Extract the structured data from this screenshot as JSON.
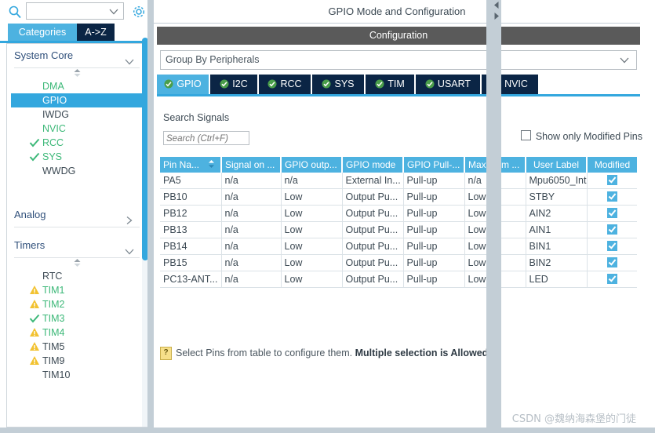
{
  "left_panel": {
    "search": {
      "value": "",
      "placeholder": ""
    },
    "search_icon": "search-icon",
    "gear_icon": "gear-icon",
    "tabs": [
      {
        "label": "Categories",
        "active": true
      },
      {
        "label": "A->Z",
        "active": false
      }
    ],
    "sections": [
      {
        "title": "System Core",
        "expanded": true,
        "items": [
          {
            "label": "DMA",
            "state": "green",
            "selected": false
          },
          {
            "label": "GPIO",
            "state": "selected",
            "selected": true
          },
          {
            "label": "IWDG",
            "state": "normal",
            "selected": false
          },
          {
            "label": "NVIC",
            "state": "green",
            "selected": false
          },
          {
            "label": "RCC",
            "state": "green",
            "selected": false,
            "mark": "check"
          },
          {
            "label": "SYS",
            "state": "green",
            "selected": false,
            "mark": "check"
          },
          {
            "label": "WWDG",
            "state": "normal",
            "selected": false
          }
        ]
      },
      {
        "title": "Analog",
        "expanded": false,
        "items": []
      },
      {
        "title": "Timers",
        "expanded": true,
        "items": [
          {
            "label": "RTC",
            "state": "normal",
            "selected": false
          },
          {
            "label": "TIM1",
            "state": "green",
            "selected": false,
            "mark": "warn"
          },
          {
            "label": "TIM2",
            "state": "green",
            "selected": false,
            "mark": "warn"
          },
          {
            "label": "TIM3",
            "state": "green",
            "selected": false,
            "mark": "check"
          },
          {
            "label": "TIM4",
            "state": "green",
            "selected": false,
            "mark": "warn"
          },
          {
            "label": "TIM5",
            "state": "normal",
            "selected": false,
            "mark": "warn"
          },
          {
            "label": "TIM9",
            "state": "normal",
            "selected": false,
            "mark": "warn"
          },
          {
            "label": "TIM10",
            "state": "normal",
            "selected": false
          }
        ]
      }
    ]
  },
  "right_panel": {
    "title": "GPIO Mode and Configuration",
    "configuration_bar": "Configuration",
    "group_by": {
      "value": "Group By Peripherals"
    },
    "peripheral_tabs": [
      {
        "label": "GPIO",
        "active": true
      },
      {
        "label": "I2C",
        "active": false
      },
      {
        "label": "RCC",
        "active": false
      },
      {
        "label": "SYS",
        "active": false
      },
      {
        "label": "TIM",
        "active": false
      },
      {
        "label": "USART",
        "active": false
      },
      {
        "label": "NVIC",
        "active": false
      }
    ],
    "search_signals": {
      "label": "Search Signals",
      "value": "",
      "placeholder": "Search (Ctrl+F)"
    },
    "show_only_modified": {
      "label": "Show only Modified Pins",
      "checked": false
    },
    "table": {
      "columns": [
        "Pin Na...",
        "Signal on ...",
        "GPIO outp...",
        "GPIO mode",
        "GPIO Pull-...",
        "Maximum ...",
        "User Label",
        "Modified"
      ],
      "sorted_column": 0,
      "rows": [
        {
          "pin": "PA5",
          "signal": "n/a",
          "output": "n/a",
          "mode": "External In...",
          "pull": "Pull-up",
          "maximum": "n/a",
          "user_label": "Mpu6050_Int",
          "modified": true
        },
        {
          "pin": "PB10",
          "signal": "n/a",
          "output": "Low",
          "mode": "Output Pu...",
          "pull": "Pull-up",
          "maximum": "Low",
          "user_label": "STBY",
          "modified": true
        },
        {
          "pin": "PB12",
          "signal": "n/a",
          "output": "Low",
          "mode": "Output Pu...",
          "pull": "Pull-up",
          "maximum": "Low",
          "user_label": "AIN2",
          "modified": true
        },
        {
          "pin": "PB13",
          "signal": "n/a",
          "output": "Low",
          "mode": "Output Pu...",
          "pull": "Pull-up",
          "maximum": "Low",
          "user_label": "AIN1",
          "modified": true
        },
        {
          "pin": "PB14",
          "signal": "n/a",
          "output": "Low",
          "mode": "Output Pu...",
          "pull": "Pull-up",
          "maximum": "Low",
          "user_label": "BIN1",
          "modified": true
        },
        {
          "pin": "PB15",
          "signal": "n/a",
          "output": "Low",
          "mode": "Output Pu...",
          "pull": "Pull-up",
          "maximum": "Low",
          "user_label": "BIN2",
          "modified": true
        },
        {
          "pin": "PC13-ANT...",
          "signal": "n/a",
          "output": "Low",
          "mode": "Output Pu...",
          "pull": "Pull-up",
          "maximum": "Low",
          "user_label": "LED",
          "modified": true
        }
      ]
    },
    "hint": {
      "icon": "help-icon",
      "text": "Select Pins from table to configure them. ",
      "bold_text": "Multiple selection is Allowed."
    }
  },
  "watermark": "CSDN @魏纳海森堡的门徒",
  "colors": {
    "accent_blue": "#4db2e0",
    "tab_dark": "#0b2545",
    "header_gray": "#5a5a5a",
    "green": "#3cb878",
    "warn_yellow": "#f2c230",
    "divider": "#c3ced6"
  }
}
